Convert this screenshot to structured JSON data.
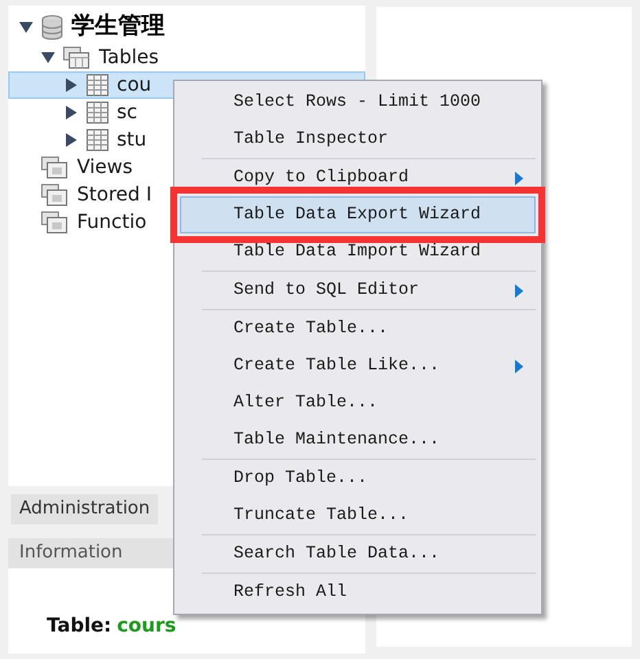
{
  "tree": {
    "label": "学生管理",
    "expanded": true,
    "children": [
      {
        "label": "Tables",
        "kind": "tables",
        "expanded": true,
        "children": [
          {
            "label": "cou",
            "kind": "table",
            "selected": true
          },
          {
            "label": "sc",
            "kind": "table",
            "selected": false
          },
          {
            "label": "stu",
            "kind": "table",
            "selected": false
          }
        ]
      },
      {
        "label": "Views",
        "kind": "folder"
      },
      {
        "label": "Stored I",
        "kind": "folder"
      },
      {
        "label": "Functio",
        "kind": "folder"
      }
    ]
  },
  "tabs": [
    {
      "label": "Administration",
      "selected": false
    }
  ],
  "info_bar": {
    "title": "Information"
  },
  "info": {
    "label": "Table:",
    "value": "cours"
  },
  "context_menu": {
    "groups": [
      [
        {
          "label": "Select Rows - Limit 1000",
          "submenu": false,
          "selected": false
        },
        {
          "label": "Table Inspector",
          "submenu": false,
          "selected": false
        }
      ],
      [
        {
          "label": "Copy to Clipboard",
          "submenu": true,
          "selected": false
        },
        {
          "label": "Table Data Export Wizard",
          "submenu": false,
          "selected": true
        },
        {
          "label": "Table Data Import Wizard",
          "submenu": false,
          "selected": false
        }
      ],
      [
        {
          "label": "Send to SQL Editor",
          "submenu": true,
          "selected": false
        }
      ],
      [
        {
          "label": "Create Table...",
          "submenu": false,
          "selected": false
        },
        {
          "label": "Create Table Like...",
          "submenu": true,
          "selected": false
        },
        {
          "label": "Alter Table...",
          "submenu": false,
          "selected": false
        },
        {
          "label": "Table Maintenance...",
          "submenu": false,
          "selected": false
        }
      ],
      [
        {
          "label": "Drop Table...",
          "submenu": false,
          "selected": false
        },
        {
          "label": "Truncate Table...",
          "submenu": false,
          "selected": false
        }
      ],
      [
        {
          "label": "Search Table Data...",
          "submenu": false,
          "selected": false
        }
      ],
      [
        {
          "label": "Refresh All",
          "submenu": false,
          "selected": false
        }
      ]
    ]
  }
}
